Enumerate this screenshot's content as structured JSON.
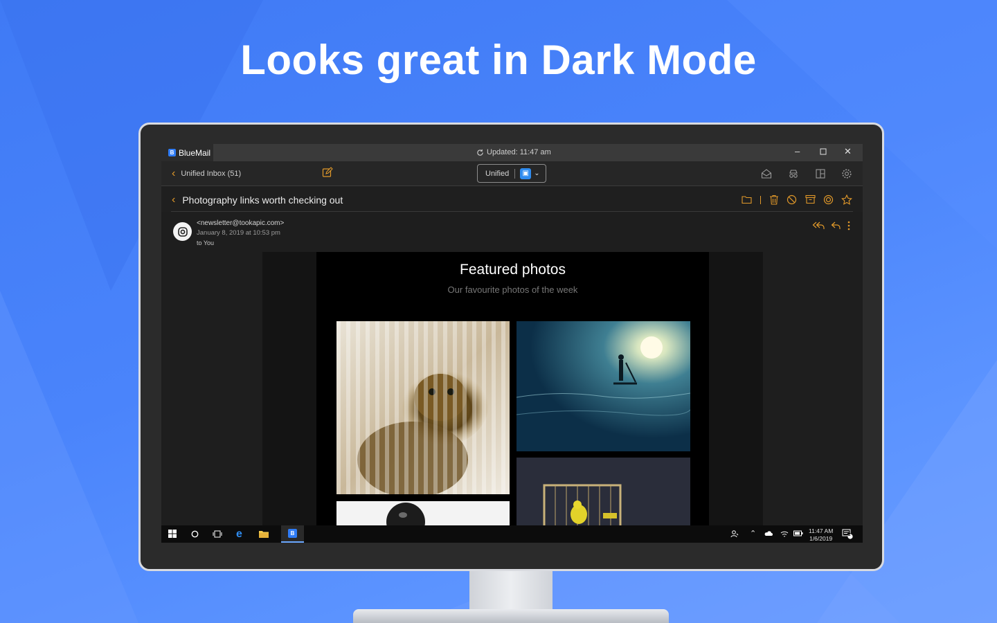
{
  "headline": "Looks great in Dark Mode",
  "colors": {
    "accent": "#e39a2a",
    "brand_blue": "#2f7cf6",
    "background": "#4a84fb"
  },
  "window": {
    "app_name": "BlueMail",
    "status": "Updated: 11:47 am",
    "controls": [
      "minimize-icon",
      "maximize-icon",
      "close-icon"
    ]
  },
  "toolbar": {
    "inbox_label": "Unified Inbox (51)",
    "account_selector": "Unified",
    "icons": [
      "compose-icon",
      "mark-read-icon",
      "incognito-icon",
      "layout-icon",
      "gear-icon"
    ]
  },
  "message": {
    "subject": "Photography links worth checking out",
    "actions": [
      "folder-icon",
      "trash-icon",
      "block-icon",
      "archive-icon",
      "snooze-icon",
      "star-icon"
    ],
    "sender": "<newsletter@tookapic.com>",
    "date": "January 8, 2019 at 10:53 pm",
    "recipient": "to You"
  },
  "email_content": {
    "title": "Featured photos",
    "subtitle": "Our favourite photos of the week"
  },
  "taskbar": {
    "time": "11:47 AM",
    "date": "1/6/2019",
    "notification_count": "2",
    "icons": [
      "windows-start-icon",
      "cortana-icon",
      "task-view-icon",
      "edge-icon",
      "file-explorer-icon",
      "bluemail-taskbar-icon"
    ]
  }
}
